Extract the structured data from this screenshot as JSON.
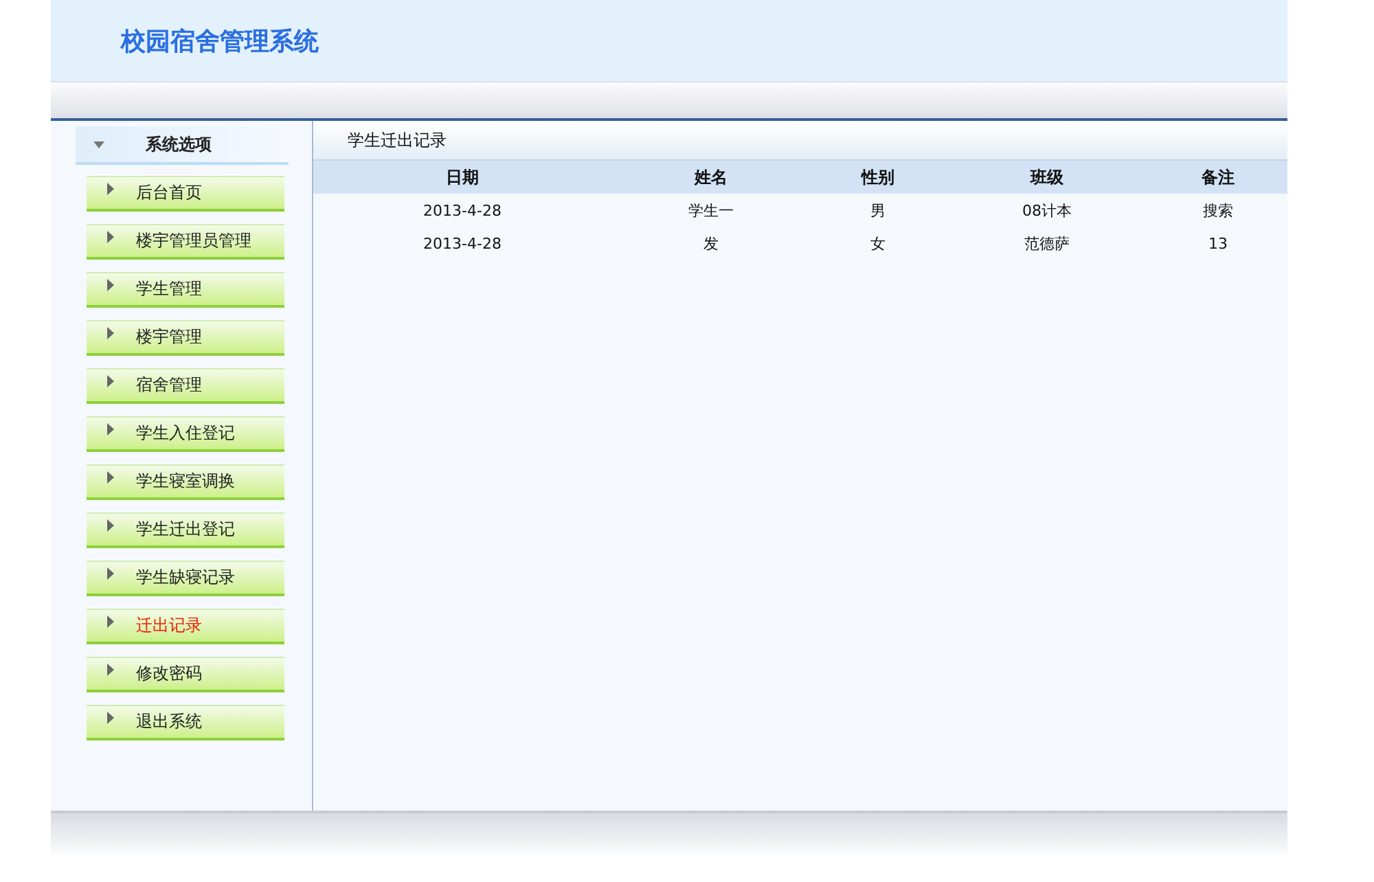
{
  "header": {
    "title": "校园宿舍管理系统"
  },
  "sidebar": {
    "title": "系统选项",
    "items": [
      {
        "label": "后台首页",
        "selected": false
      },
      {
        "label": "楼宇管理员管理",
        "selected": false
      },
      {
        "label": "学生管理",
        "selected": false
      },
      {
        "label": "楼宇管理",
        "selected": false
      },
      {
        "label": "宿舍管理",
        "selected": false
      },
      {
        "label": "学生入住登记",
        "selected": false
      },
      {
        "label": "学生寝室调换",
        "selected": false
      },
      {
        "label": "学生迁出登记",
        "selected": false
      },
      {
        "label": "学生缺寝记录",
        "selected": false
      },
      {
        "label": "迁出记录",
        "selected": true
      },
      {
        "label": "修改密码",
        "selected": false
      },
      {
        "label": "退出系统",
        "selected": false
      }
    ]
  },
  "content": {
    "title": "学生迁出记录",
    "table": {
      "columns": [
        "日期",
        "姓名",
        "性别",
        "班级",
        "备注"
      ],
      "rows": [
        [
          "2013-4-28",
          "学生一",
          "男",
          "08计本",
          "搜索"
        ],
        [
          "2013-4-28",
          "发",
          "女",
          "范德萨",
          "13"
        ]
      ]
    }
  }
}
